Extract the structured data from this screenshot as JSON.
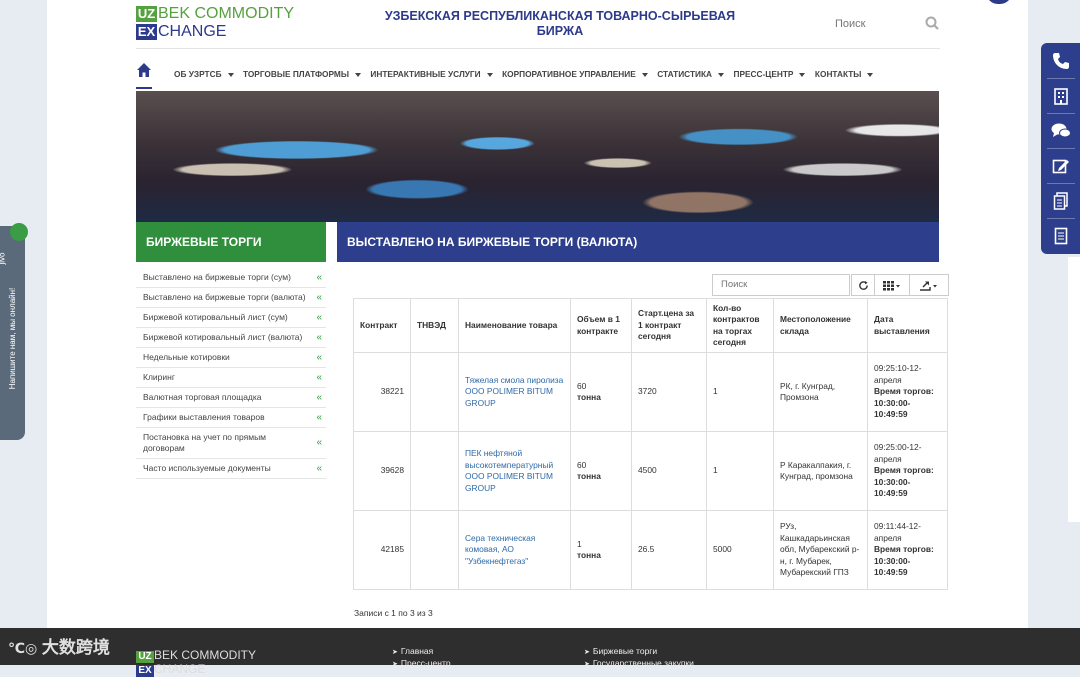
{
  "logo": {
    "uz": "UZ",
    "bek": "BEK COMMODITY",
    "ex": "EX",
    "change": "CHANGE"
  },
  "site_title": "УЗБЕКСКАЯ РЕСПУБЛИКАНСКАЯ ТОВАРНО-СЫРЬЕВАЯ БИРЖА",
  "search": {
    "placeholder": "Поиск"
  },
  "nav": {
    "items": [
      "ОБ УЗРТСБ",
      "ТОРГОВЫЕ ПЛАТФОРМЫ",
      "ИНТЕРАКТИВНЫЕ УСЛУГИ",
      "КОРПОРАТИВНОЕ УПРАВЛЕНИЕ",
      "СТАТИСТИКА",
      "ПРЕСС-ЦЕНТР",
      "КОНТАКТЫ"
    ]
  },
  "sections": {
    "left_title": "БИРЖЕВЫЕ ТОРГИ",
    "right_title": "ВЫСТАВЛЕНО НА БИРЖЕВЫЕ ТОРГИ (ВАЛЮТА)"
  },
  "sidemenu": [
    "Выставлено на биржевые торги (сум)",
    "Выставлено на биржевые торги (валюта)",
    "Биржевой котировальный лист (сум)",
    "Биржевой котировальный лист (валюта)",
    "Недельные котировки",
    "Клиринг",
    "Валютная торговая площадка",
    "Графики выставления товаров",
    "Постановка на учет по прямым договорам",
    "Часто используемые документы"
  ],
  "table_search": {
    "placeholder": "Поиск"
  },
  "table": {
    "headers": [
      "Контракт",
      "ТНВЭД",
      "Наименование товара",
      "Объем в 1 контракте",
      "Старт.цена за 1 контракт сегодня",
      "Кол-во контрактов на торгах сегодня",
      "Местоположение склада",
      "Дата выставления"
    ],
    "rows": [
      {
        "contract": "38221",
        "tnved": "",
        "name": "Тяжелая смола пиролиза ООО POLIMER BITUM GROUP",
        "volume": "60",
        "unit": "тонна",
        "price": "3720",
        "count": "1",
        "location": "РК, г. Кунград, Промзона",
        "date": "09:25:10-12-апреля",
        "trade_label": "Время торгов:",
        "trade_time": "10:30:00-10:49:59"
      },
      {
        "contract": "39628",
        "tnved": "",
        "name": "ПЕК нефтяной высокотемпературный ООО POLIMER BITUM GROUP",
        "volume": "60",
        "unit": "тонна",
        "price": "4500",
        "count": "1",
        "location": "Р Каракалпакия, г. Кунград, промзона",
        "date": "09:25:00-12-апреля",
        "trade_label": "Время торгов:",
        "trade_time": "10:30:00-10:49:59"
      },
      {
        "contract": "42185",
        "tnved": "",
        "name": "Сера техническая комовая, АО \"Узбекнефтегаз\"",
        "volume": "1",
        "unit": "тонна",
        "price": "26.5",
        "count": "5000",
        "location": "РУз, Кашкадарьинская обл, Мубарекский р-н, г. Мубарек, Мубарекский ГПЗ",
        "date": "09:11:44-12-апреля",
        "trade_label": "Время торгов:",
        "trade_time": "10:30:00-10:49:59"
      }
    ]
  },
  "records_text": "Записи с 1 по 3 из 3",
  "footer": {
    "col1": [
      "Главная",
      "Пресс-центр"
    ],
    "col2": [
      "Биржевые торги",
      "Государственные закупки"
    ]
  },
  "chat": {
    "label": "Напишите нам, мы онлайн!",
    "brand": "jivo"
  },
  "watermark": "大数跨境",
  "colors": {
    "brand_blue": "#2d3e8c",
    "brand_green": "#2f8f3c",
    "link": "#2e6aa8"
  }
}
